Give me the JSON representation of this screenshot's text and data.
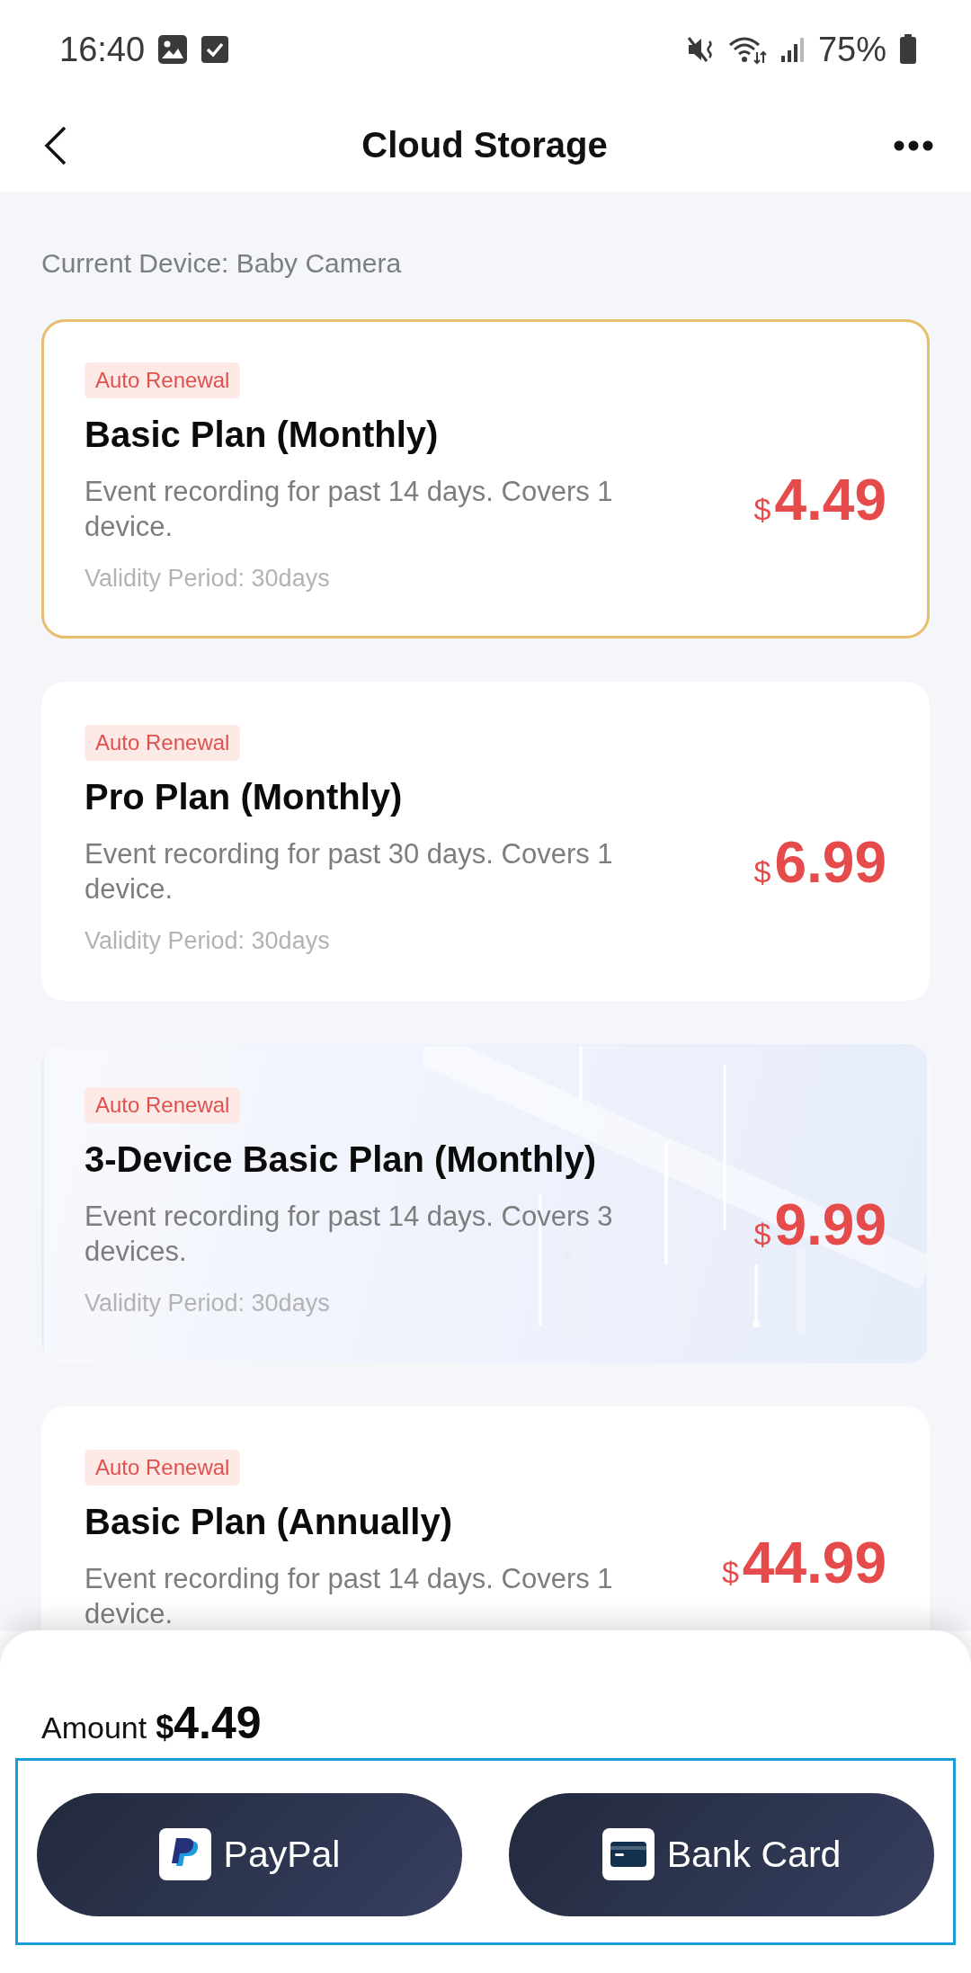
{
  "status_bar": {
    "time": "16:40",
    "battery": "75%"
  },
  "header": {
    "title": "Cloud Storage"
  },
  "current_device": "Current Device: Baby Camera",
  "plans": [
    {
      "kind": "plain",
      "selected": true,
      "badge": "Auto Renewal",
      "name": "Basic Plan (Monthly)",
      "description": "Event recording for past 14 days. Covers 1 device.",
      "validity": "Validity Period: 30days",
      "currency": "$",
      "price": "4.49"
    },
    {
      "kind": "plain",
      "selected": false,
      "badge": "Auto Renewal",
      "name": "Pro Plan (Monthly)",
      "description": "Event recording for past 30 days. Covers 1 device.",
      "validity": "Validity Period: 30days",
      "currency": "$",
      "price": "6.99"
    },
    {
      "kind": "featured",
      "selected": false,
      "badge": "Auto Renewal",
      "name": "3-Device Basic Plan (Monthly)",
      "description": "Event recording for past 14 days. Covers 3 devices.",
      "validity": "Validity Period: 30days",
      "currency": "$",
      "price": "9.99"
    },
    {
      "kind": "plain",
      "selected": false,
      "badge": "Auto Renewal",
      "name": "Basic Plan (Annually)",
      "description": "Event recording for past 14 days. Covers 1 device.",
      "currency": "$",
      "price": "44.99"
    }
  ],
  "payment": {
    "amount_label": "Amount",
    "currency": "$",
    "amount": "4.49",
    "methods": [
      {
        "kind": "paypal",
        "label": "PayPal"
      },
      {
        "kind": "card",
        "label": "Bank Card"
      }
    ]
  }
}
